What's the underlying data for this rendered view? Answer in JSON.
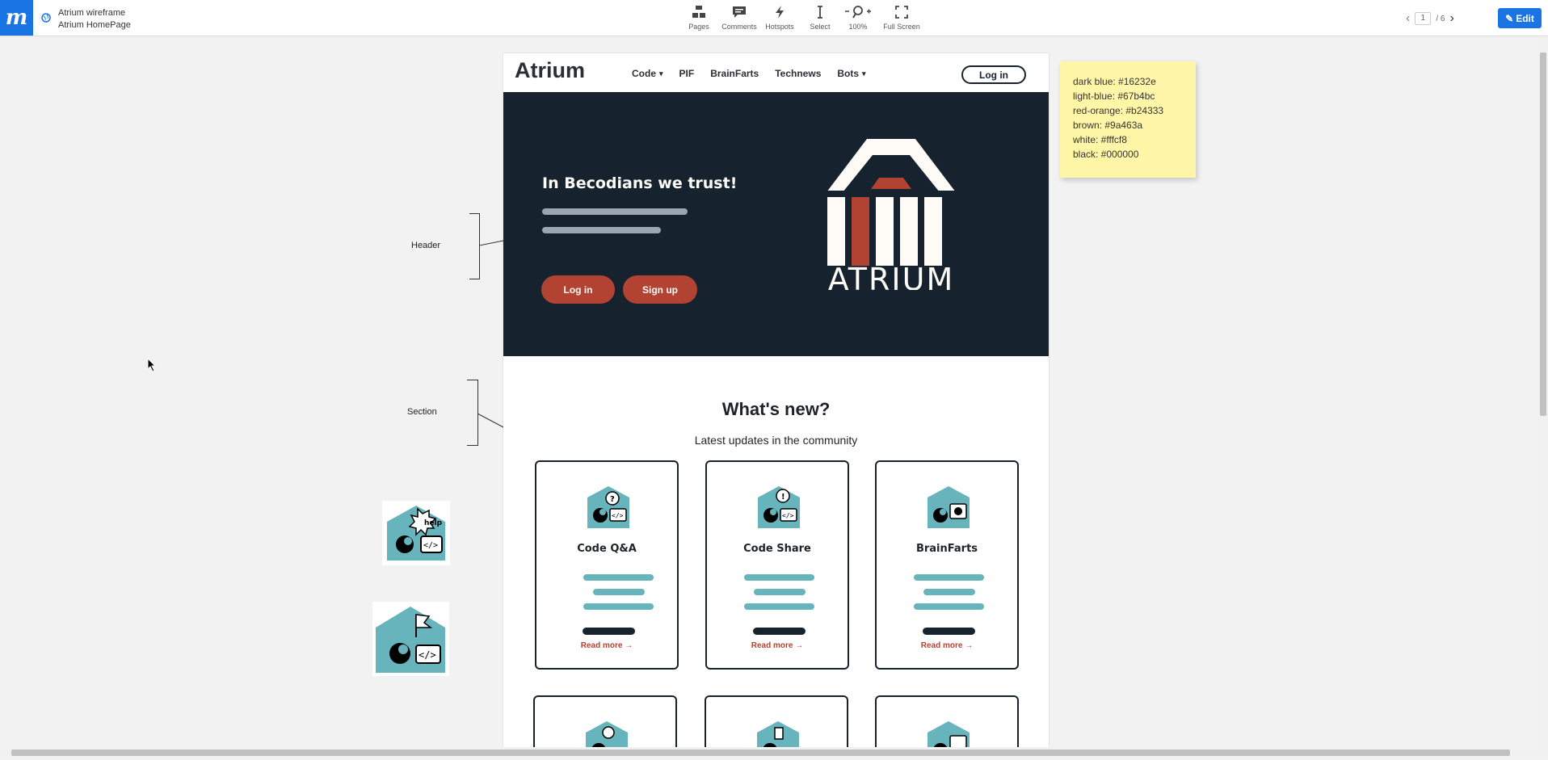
{
  "app": {
    "logo_letter": "m",
    "project_title": "Atrium wireframe",
    "page_title": "Atrium HomePage",
    "accent_color": "#1b74e4"
  },
  "toolbar": {
    "pages": "Pages",
    "comments": "Comments",
    "hotspots": "Hotspots",
    "select": "Select",
    "zoom": "100%",
    "fullscreen": "Full Screen"
  },
  "pager": {
    "current": "1",
    "total": "/ 6"
  },
  "edit_label": "Edit",
  "annotations": {
    "header": "Header",
    "section": "Section"
  },
  "palette_note": [
    "dark blue: #16232e",
    "light-blue: #67b4bc",
    "red-orange: #b24333",
    "brown: #9a463a",
    "white: #fffcf8",
    "black: #000000"
  ],
  "site": {
    "brand": "Atrium",
    "nav": [
      "Code",
      "PIF",
      "BrainFarts",
      "Technews",
      "Bots"
    ],
    "nav_login": "Log in",
    "hero_title": "In Becodians we trust!",
    "hero_logo_text": "ATRIUM",
    "hero_login": "Log in",
    "hero_signup": "Sign up",
    "section_title": "What's new?",
    "section_subtitle": "Latest updates in the community",
    "cards": [
      {
        "title": "Code Q&A",
        "read_more": "Read more →"
      },
      {
        "title": "Code Share",
        "read_more": "Read more →"
      },
      {
        "title": "BrainFarts",
        "read_more": "Read more →"
      }
    ]
  },
  "colors": {
    "dark_blue": "#16232e",
    "light_blue": "#67b4bc",
    "red_orange": "#b24333",
    "white": "#fffcf8"
  }
}
